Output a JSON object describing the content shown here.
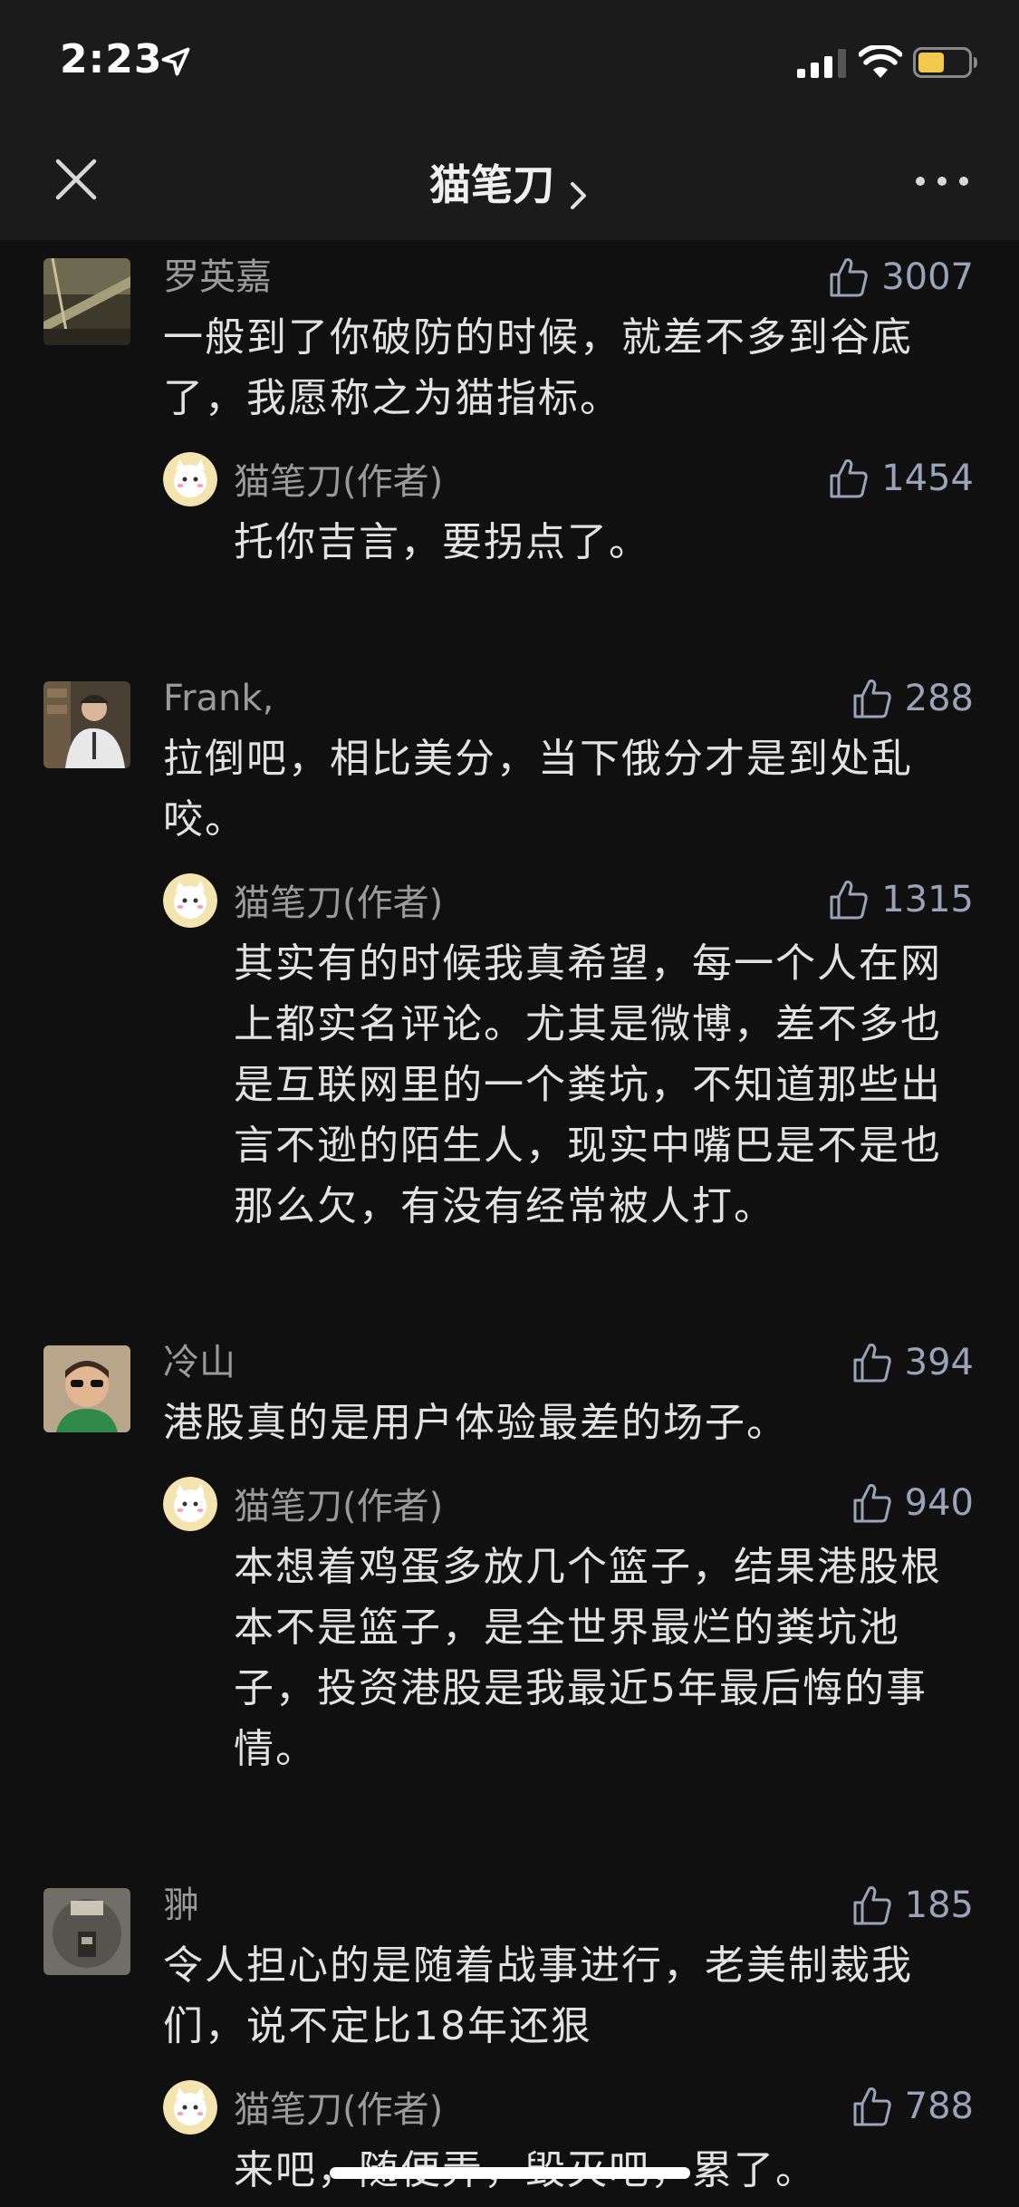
{
  "status_bar": {
    "time": "2:23"
  },
  "nav": {
    "title": "猫笔刀"
  },
  "comments": [
    {
      "user": "罗英嘉",
      "likes": "3007",
      "text": "一般到了你破防的时候，就差不多到谷底了，我愿称之为猫指标。",
      "reply": {
        "user": "猫笔刀(作者)",
        "likes": "1454",
        "text": "托你吉言，要拐点了。"
      }
    },
    {
      "user": "Frank,",
      "likes": "288",
      "text": "拉倒吧，相比美分，当下俄分才是到处乱咬。",
      "reply": {
        "user": "猫笔刀(作者)",
        "likes": "1315",
        "text": "其实有的时候我真希望，每一个人在网上都实名评论。尤其是微博，差不多也是互联网里的一个粪坑，不知道那些出言不逊的陌生人，现实中嘴巴是不是也那么欠，有没有经常被人打。"
      }
    },
    {
      "user": "冷山",
      "likes": "394",
      "text": "港股真的是用户体验最差的场子。",
      "reply": {
        "user": "猫笔刀(作者)",
        "likes": "940",
        "text": "本想着鸡蛋多放几个篮子，结果港股根本不是篮子，是全世界最烂的粪坑池子，投资港股是我最近5年最后悔的事情。"
      }
    },
    {
      "user": "翀",
      "likes": "185",
      "text": "令人担心的是随着战事进行，老美制裁我们，说不定比18年还狠",
      "reply": {
        "user": "猫笔刀(作者)",
        "likes": "788",
        "text": "来吧，随便弄，毁灭吧，累了。"
      }
    }
  ],
  "icons": {
    "close": "close-icon",
    "more": "more-icon",
    "like": "thumbs-up-icon",
    "chevron": "chevron-right-icon"
  },
  "colors": {
    "background": "#101010",
    "bar": "#1b1b1b",
    "like_count": "#9aa3b8",
    "battery_fill": "#f2c94c"
  }
}
